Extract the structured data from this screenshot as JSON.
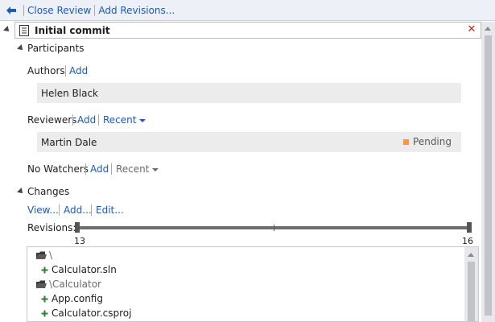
{
  "toolbar": {
    "back_icon": "back-arrow-icon",
    "close_review": "Close Review",
    "add_revisions": "Add Revisions..."
  },
  "review": {
    "title": "Initial commit",
    "close_icon": "close-x-icon",
    "close_color": "#c0281e"
  },
  "participants": {
    "heading": "Participants",
    "authors_label": "Authors",
    "authors_add": "Add",
    "authors": [
      {
        "name": "Helen Black"
      }
    ],
    "reviewers_label": "Reviewers",
    "reviewers_add": "Add",
    "reviewers_recent": "Recent",
    "reviewers": [
      {
        "name": "Martin Dale",
        "status": "Pending",
        "status_color": "#f59a36"
      }
    ],
    "watchers_label": "No Watchers",
    "watchers_add": "Add",
    "watchers_recent": "Recent"
  },
  "changes": {
    "heading": "Changes",
    "view": "View...",
    "add": "Add...",
    "edit": "Edit...",
    "revisions_label": "Revisions:",
    "revision_min": "13",
    "revision_max": "16",
    "files": [
      {
        "type": "folder",
        "label": "\\"
      },
      {
        "type": "file",
        "label": "Calculator.sln"
      },
      {
        "type": "folder",
        "label": "\\Calculator"
      },
      {
        "type": "file",
        "label": "App.config"
      },
      {
        "type": "file",
        "label": "Calculator.csproj"
      }
    ]
  },
  "colors": {
    "link": "#1a5ab8",
    "toolbar_bg": "#eef0f7",
    "added_plus": "#2e7d32"
  }
}
